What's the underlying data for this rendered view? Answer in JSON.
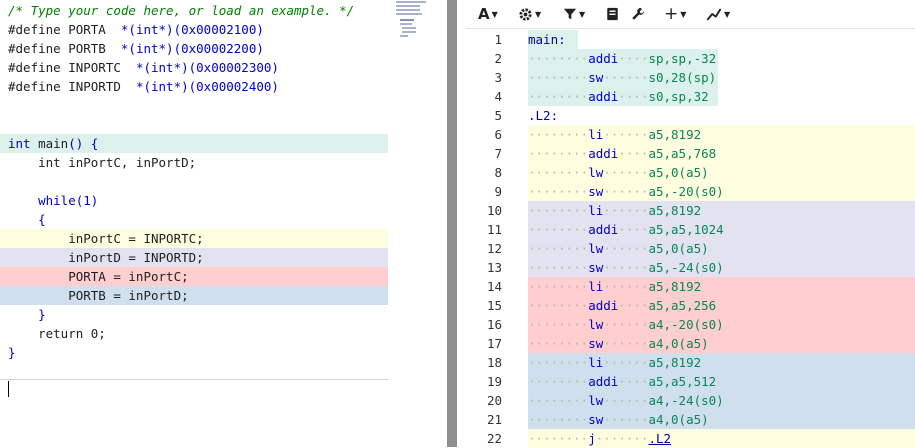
{
  "colors": {
    "main": "#dcf0ec",
    "c1": "#fffde0",
    "c2": "#e2e2f0",
    "c3": "#ffcece",
    "c4": "#cfdfee",
    "nohl": "transparent"
  },
  "source": {
    "lines": [
      {
        "hl": "nohl",
        "tokens": [
          {
            "t": "/* Type your code here, or load an example. */",
            "c": "comment"
          }
        ]
      },
      {
        "hl": "nohl",
        "tokens": [
          {
            "t": "#define PORTA  ",
            "c": "plain"
          },
          {
            "t": "*(int*)(0x00002100)",
            "c": "kw"
          }
        ]
      },
      {
        "hl": "nohl",
        "tokens": [
          {
            "t": "#define PORTB  ",
            "c": "plain"
          },
          {
            "t": "*(int*)(0x00002200)",
            "c": "kw"
          }
        ]
      },
      {
        "hl": "nohl",
        "tokens": [
          {
            "t": "#define INPORTC  ",
            "c": "plain"
          },
          {
            "t": "*(int*)(0x00002300)",
            "c": "kw"
          }
        ]
      },
      {
        "hl": "nohl",
        "tokens": [
          {
            "t": "#define INPORTD  ",
            "c": "plain"
          },
          {
            "t": "*(int*)(0x00002400)",
            "c": "kw"
          }
        ]
      },
      {
        "hl": "nohl",
        "tokens": []
      },
      {
        "hl": "nohl",
        "tokens": []
      },
      {
        "hl": "main",
        "tokens": [
          {
            "t": "int",
            "c": "kw"
          },
          {
            "t": " main",
            "c": "plain"
          },
          {
            "t": "() {",
            "c": "kw"
          }
        ]
      },
      {
        "hl": "nohl",
        "tokens": [
          {
            "t": "    int inPortC, inPortD;",
            "c": "plain"
          }
        ]
      },
      {
        "hl": "nohl",
        "tokens": []
      },
      {
        "hl": "nohl",
        "tokens": [
          {
            "t": "    while",
            "c": "kw"
          },
          {
            "t": "(1)",
            "c": "kw"
          }
        ]
      },
      {
        "hl": "nohl",
        "tokens": [
          {
            "t": "    {",
            "c": "kw"
          }
        ]
      },
      {
        "hl": "c1",
        "tokens": [
          {
            "t": "        inPortC = INPORTC;",
            "c": "plain"
          }
        ]
      },
      {
        "hl": "c2",
        "tokens": [
          {
            "t": "        inPortD = INPORTD;",
            "c": "plain"
          }
        ]
      },
      {
        "hl": "c3",
        "tokens": [
          {
            "t": "        PORTA = inPortC;",
            "c": "plain"
          }
        ]
      },
      {
        "hl": "c4",
        "tokens": [
          {
            "t": "        PORTB = inPortD;",
            "c": "plain"
          }
        ]
      },
      {
        "hl": "nohl",
        "tokens": [
          {
            "t": "    }",
            "c": "kw"
          }
        ]
      },
      {
        "hl": "nohl",
        "tokens": [
          {
            "t": "    return 0;",
            "c": "plain"
          }
        ]
      },
      {
        "hl": "nohl",
        "tokens": [
          {
            "t": "}",
            "c": "kw"
          }
        ]
      }
    ]
  },
  "toolbar": {
    "font_icon": "A",
    "settings_icon": "gear-icon",
    "filter_icon": "filter-icon",
    "libs_icon": "book-icon",
    "tools_icon": "wrench-icon",
    "add_label": "+",
    "graph_icon": "graph-icon"
  },
  "asm": {
    "lines": [
      {
        "n": "1",
        "hl": "main",
        "label": "main:"
      },
      {
        "n": "2",
        "hl": "main",
        "op": "addi",
        "args": "sp,sp,-32"
      },
      {
        "n": "3",
        "hl": "main",
        "op": "sw",
        "args": "s0,28(sp)"
      },
      {
        "n": "4",
        "hl": "main",
        "op": "addi",
        "args": "s0,sp,32"
      },
      {
        "n": "5",
        "hl": "nohl",
        "label": ".L2:"
      },
      {
        "n": "6",
        "hl": "c1",
        "op": "li",
        "args": "a5,8192"
      },
      {
        "n": "7",
        "hl": "c1",
        "op": "addi",
        "args": "a5,a5,768"
      },
      {
        "n": "8",
        "hl": "c1",
        "op": "lw",
        "args": "a5,0(a5)"
      },
      {
        "n": "9",
        "hl": "c1",
        "op": "sw",
        "args": "a5,-20(s0)"
      },
      {
        "n": "10",
        "hl": "c2",
        "op": "li",
        "args": "a5,8192"
      },
      {
        "n": "11",
        "hl": "c2",
        "op": "addi",
        "args": "a5,a5,1024"
      },
      {
        "n": "12",
        "hl": "c2",
        "op": "lw",
        "args": "a5,0(a5)"
      },
      {
        "n": "13",
        "hl": "c2",
        "op": "sw",
        "args": "a5,-24(s0)"
      },
      {
        "n": "14",
        "hl": "c3",
        "op": "li",
        "args": "a5,8192"
      },
      {
        "n": "15",
        "hl": "c3",
        "op": "addi",
        "args": "a5,a5,256"
      },
      {
        "n": "16",
        "hl": "c3",
        "op": "lw",
        "args": "a4,-20(s0)"
      },
      {
        "n": "17",
        "hl": "c3",
        "op": "sw",
        "args": "a4,0(a5)"
      },
      {
        "n": "18",
        "hl": "c4",
        "op": "li",
        "args": "a5,8192"
      },
      {
        "n": "19",
        "hl": "c4",
        "op": "addi",
        "args": "a5,a5,512"
      },
      {
        "n": "20",
        "hl": "c4",
        "op": "lw",
        "args": "a4,-24(s0)"
      },
      {
        "n": "21",
        "hl": "c4",
        "op": "sw",
        "args": "a4,0(a5)"
      },
      {
        "n": "22",
        "hl": "c1",
        "op": "j",
        "args": ".L2",
        "link": true
      }
    ]
  }
}
